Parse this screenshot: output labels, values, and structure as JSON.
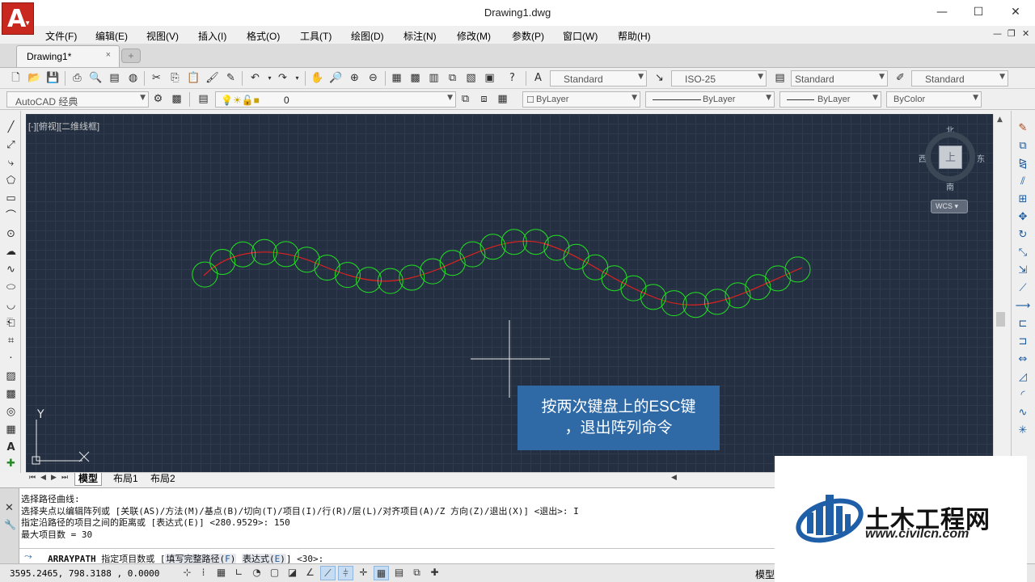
{
  "window": {
    "title": "Drawing1.dwg",
    "minimize": "—",
    "maximize": "☐",
    "close": "✕"
  },
  "menu": {
    "items": [
      "文件(F)",
      "编辑(E)",
      "视图(V)",
      "插入(I)",
      "格式(O)",
      "工具(T)",
      "绘图(D)",
      "标注(N)",
      "修改(M)",
      "参数(P)",
      "窗口(W)",
      "帮助(H)"
    ]
  },
  "tabs": {
    "document": "Drawing1*",
    "close": "×",
    "new": "+"
  },
  "toolbar1": {
    "text_style": "Standard",
    "dim_style": "ISO-25",
    "table_style": "Standard",
    "mleader_style": "Standard"
  },
  "toolbar2": {
    "workspace": "AutoCAD 经典",
    "layer": "0",
    "color": "ByLayer",
    "linetype": "ByLayer",
    "lineweight": "ByLayer",
    "plotstyle": "ByColor"
  },
  "viewport": {
    "label": "[-][俯视][二维线框]"
  },
  "viewcube": {
    "north": "北",
    "south": "南",
    "east": "东",
    "west": "西",
    "top": "上",
    "wcs": "WCS"
  },
  "ucs": {
    "x": "X",
    "y": "Y"
  },
  "drawing": {
    "path_color": "#e02020",
    "circle_color": "#22e022",
    "circle_count": 30,
    "circle_spacing": 150
  },
  "callout": {
    "line1": "按两次键盘上的ESC键",
    "line2": "，退出阵列命令",
    "color": "#2f6aa6"
  },
  "layout_tabs": [
    "模型",
    "布局1",
    "布局2"
  ],
  "command": {
    "history": [
      "选择路径曲线:",
      "选择夹点以编辑阵列或 [关联(AS)/方法(M)/基点(B)/切向(T)/项目(I)/行(R)/层(L)/对齐项目(A)/Z 方向(Z)/退出(X)] <退出>: I",
      "指定沿路径的项目之间的距离或 [表达式(E)] <280.9529>: 150",
      "最大项目数 = 30"
    ],
    "input": {
      "name": "ARRAYPATH",
      "prompt": "指定项目数或 [",
      "opt1": "填写完整路径(",
      "opt1_key": "F",
      "opt1_end": ")",
      "opt2": "表达式(",
      "opt2_key": "E",
      "opt2_end": ")",
      "tail": "] <30>:"
    }
  },
  "status": {
    "coords": "3595.2465, 798.3188 , 0.0000",
    "model": "模型"
  },
  "watermark": {
    "title": "土木工程网",
    "url": "www.civilcn.com"
  }
}
